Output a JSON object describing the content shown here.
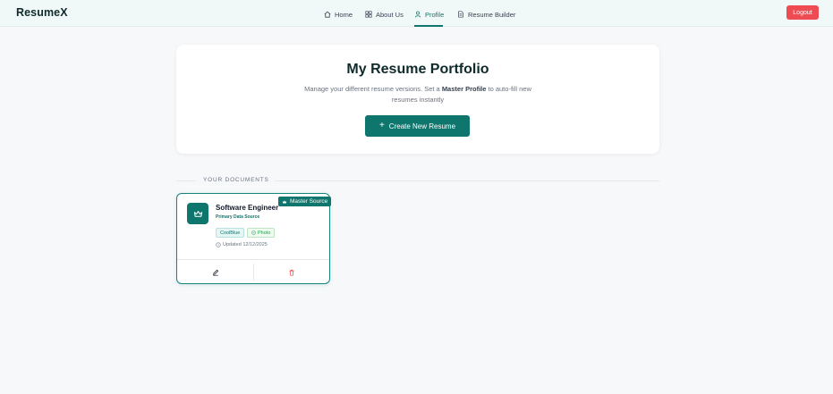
{
  "app": {
    "brand": "ResumeX"
  },
  "nav": {
    "items": [
      {
        "label": "Home",
        "icon": "home-icon"
      },
      {
        "label": "About Us",
        "icon": "grid-icon"
      },
      {
        "label": "Profile",
        "icon": "user-icon",
        "active": true
      },
      {
        "label": "Resume Builder",
        "icon": "document-icon"
      }
    ],
    "logout_label": "Logout"
  },
  "hero": {
    "title": "My Resume Portfolio",
    "subtitle_prefix": "Manage your different resume versions. Set a ",
    "subtitle_bold": "Master Profile",
    "subtitle_suffix": " to auto-fill new resumes instantly",
    "create_label": "Create New Resume"
  },
  "section": {
    "label": "YOUR DOCUMENTS"
  },
  "documents": [
    {
      "badge": "Master Source",
      "title": "Software Engineer",
      "subtitle": "Primary Data Source",
      "theme_tag": "CoolBlue",
      "photo_tag": "Photo",
      "updated": "Updated 12/12/2025"
    }
  ],
  "colors": {
    "accent": "#0f766e",
    "logout": "#ef4b53",
    "delete": "#ef4444"
  }
}
